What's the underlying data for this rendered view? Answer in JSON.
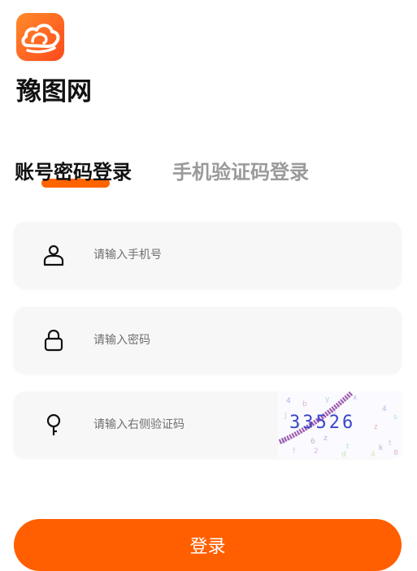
{
  "app": {
    "name": "豫图网",
    "logo_icon": "cloud-logo-icon",
    "brand_color": "#ff5f00"
  },
  "tabs": [
    {
      "label": "账号密码登录",
      "active": true
    },
    {
      "label": "手机验证码登录",
      "active": false
    }
  ],
  "fields": {
    "phone": {
      "placeholder": "请输入手机号",
      "value": "",
      "icon": "user-icon"
    },
    "password": {
      "placeholder": "请输入密码",
      "value": "",
      "icon": "lock-icon"
    },
    "captcha": {
      "placeholder": "请输入右侧验证码",
      "value": "",
      "icon": "key-icon"
    }
  },
  "captcha_image": {
    "code": "33526"
  },
  "login_button": {
    "label": "登录"
  }
}
